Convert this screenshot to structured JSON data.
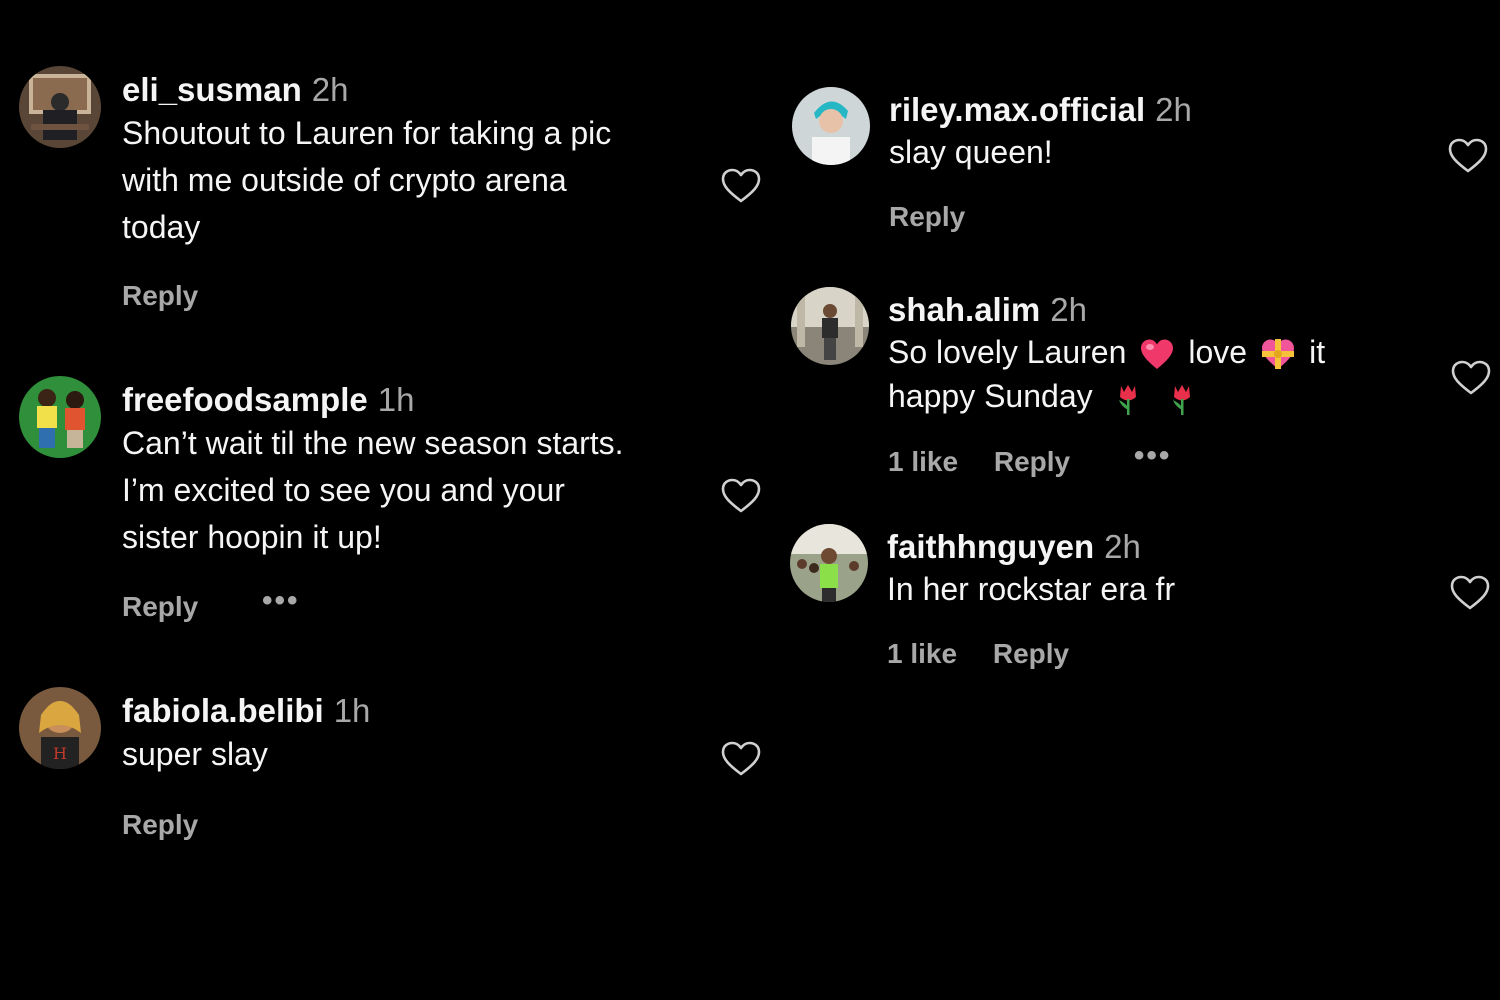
{
  "comments_left": [
    {
      "username": "eli_susman",
      "time": "2h",
      "lines": [
        "Shoutout to Lauren for taking a pic",
        "with me outside of crypto arena",
        "today"
      ],
      "reply": "Reply",
      "avatar_icon": "user-avatar-photo",
      "like_icon": "heart-outline-icon"
    },
    {
      "username": "freefoodsample",
      "time": "1h",
      "lines": [
        "Can’t wait til the new season starts.",
        "I’m excited to see you and your",
        "sister hoopin it up!"
      ],
      "reply": "Reply",
      "more": "•••",
      "avatar_icon": "user-avatar-photo",
      "like_icon": "heart-outline-icon"
    },
    {
      "username": "fabiola.belibi",
      "time": "1h",
      "lines": [
        "super slay"
      ],
      "reply": "Reply",
      "avatar_icon": "user-avatar-photo",
      "like_icon": "heart-outline-icon"
    }
  ],
  "comments_right": [
    {
      "username": "riley.max.official",
      "time": "2h",
      "lines": [
        "slay queen!"
      ],
      "reply": "Reply",
      "avatar_icon": "user-avatar-photo",
      "like_icon": "heart-outline-icon"
    },
    {
      "username": "shah.alim",
      "time": "2h",
      "line1_parts": [
        "So lovely Lauren",
        "love",
        "it"
      ],
      "line2_parts": [
        "happy Sunday"
      ],
      "emojis": [
        "red-heart-emoji",
        "heart-with-ribbon-emoji",
        "tulip-emoji",
        "tulip-emoji"
      ],
      "likes": "1 like",
      "reply": "Reply",
      "more": "•••",
      "avatar_icon": "user-avatar-photo",
      "like_icon": "heart-outline-icon"
    },
    {
      "username": "faithhnguyen",
      "time": "2h",
      "lines": [
        "In her rockstar era fr"
      ],
      "likes": "1 like",
      "reply": "Reply",
      "avatar_icon": "user-avatar-photo",
      "like_icon": "heart-outline-icon"
    }
  ],
  "colors": {
    "background": "#000000",
    "text": "#f5f5f5",
    "secondary": "#a8a8a8",
    "heart_stroke": "#d0d0d0"
  }
}
